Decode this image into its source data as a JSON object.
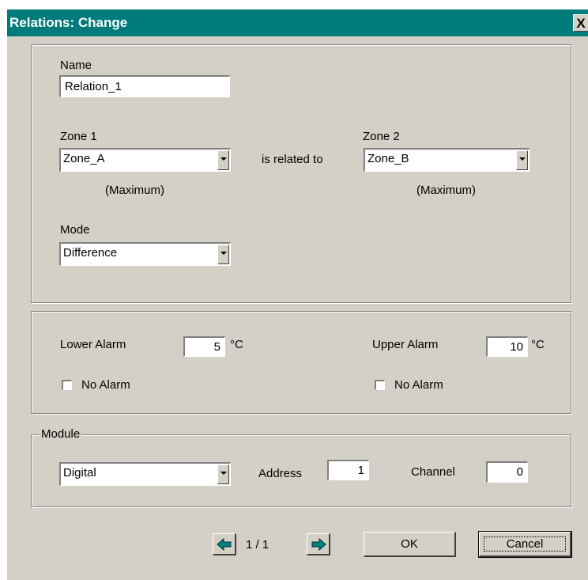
{
  "window": {
    "title": "Relations: Change",
    "close_glyph": "X"
  },
  "relation": {
    "name_label": "Name",
    "name_value": "Relation_1",
    "zone1_label": "Zone 1",
    "zone1_value": "Zone_A",
    "zone1_note": "(Maximum)",
    "related_text": "is related to",
    "zone2_label": "Zone 2",
    "zone2_value": "Zone_B",
    "zone2_note": "(Maximum)",
    "mode_label": "Mode",
    "mode_value": "Difference"
  },
  "alarms": {
    "lower_label": "Lower Alarm",
    "lower_value": "5",
    "lower_unit": "°C",
    "lower_no_alarm_label": "No Alarm",
    "lower_no_alarm_checked": false,
    "upper_label": "Upper Alarm",
    "upper_value": "10",
    "upper_unit": "°C",
    "upper_no_alarm_label": "No Alarm",
    "upper_no_alarm_checked": false
  },
  "module": {
    "legend": "Module",
    "type_value": "Digital",
    "address_label": "Address",
    "address_value": "1",
    "channel_label": "Channel",
    "channel_value": "0"
  },
  "footer": {
    "page_indicator": "1 / 1",
    "ok_label": "OK",
    "cancel_label": "Cancel"
  },
  "icons": {
    "prev": "arrow-left-icon",
    "next": "arrow-right-icon",
    "arrow_color": "#008080"
  }
}
